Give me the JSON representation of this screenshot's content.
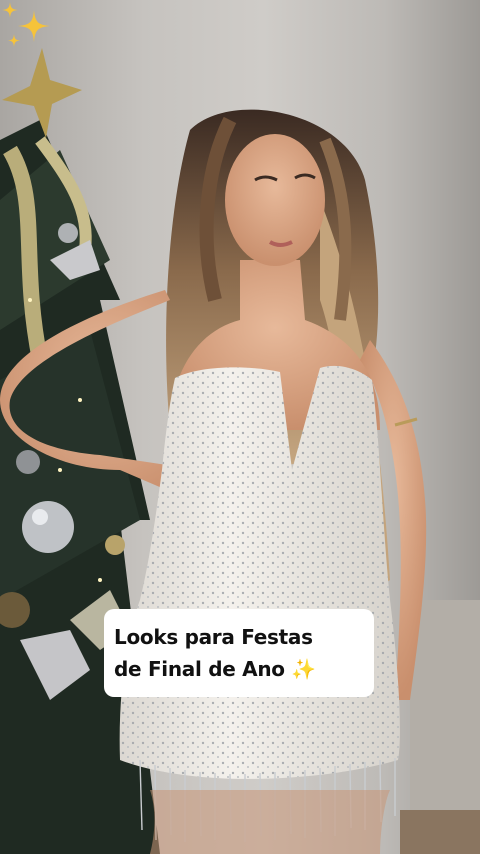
{
  "photo": {
    "description_icon": "woman-in-sequin-dress-photo",
    "background_color": "#c6c3bf",
    "dress_color": "#f2efea",
    "tree_color": "#1f2a22"
  },
  "caption": {
    "line1": "Looks para Festas",
    "line2": "de Final de Ano ✨"
  },
  "decorations": {
    "side_sparkle_icon": "sparkles-icon",
    "sparkle_color": "#f6c33a"
  }
}
